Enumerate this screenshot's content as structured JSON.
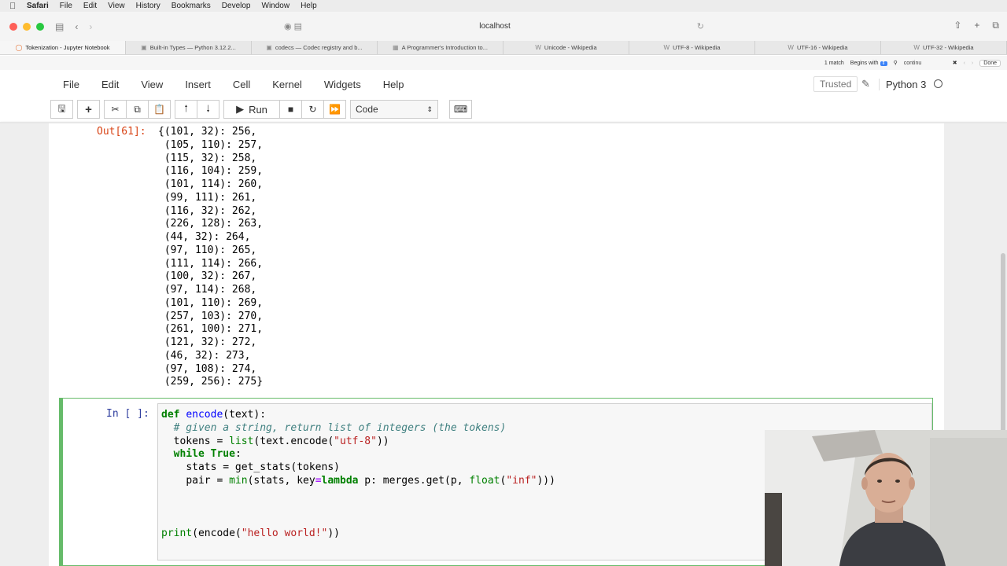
{
  "macos_menu": {
    "apple": "",
    "items": [
      "Safari",
      "File",
      "Edit",
      "View",
      "History",
      "Bookmarks",
      "Develop",
      "Window",
      "Help"
    ]
  },
  "browser": {
    "address": "localhost",
    "tabs": [
      {
        "label": "Tokenization - Jupyter Notebook",
        "active": true
      },
      {
        "label": "Built-in Types — Python 3.12.2...",
        "active": false
      },
      {
        "label": "codecs — Codec registry and b...",
        "active": false
      },
      {
        "label": "A Programmer's Introduction to...",
        "active": false
      },
      {
        "label": "Unicode - Wikipedia",
        "active": false
      },
      {
        "label": "UTF-8 - Wikipedia",
        "active": false
      },
      {
        "label": "UTF-16 - Wikipedia",
        "active": false
      },
      {
        "label": "UTF-32 - Wikipedia",
        "active": false
      }
    ],
    "find": {
      "match_count": "1 match",
      "mode": "Begins with",
      "query": "continu",
      "done": "Done"
    }
  },
  "jupyter": {
    "menu": [
      "File",
      "Edit",
      "View",
      "Insert",
      "Cell",
      "Kernel",
      "Widgets",
      "Help"
    ],
    "trusted": "Trusted",
    "kernel_name": "Python 3",
    "toolbar": {
      "run_label": "Run",
      "cell_type": "Code"
    }
  },
  "output_cell": {
    "prompt": "Out[61]:",
    "lines": [
      "{(101, 32): 256,",
      " (105, 110): 257,",
      " (115, 32): 258,",
      " (116, 104): 259,",
      " (101, 114): 260,",
      " (99, 111): 261,",
      " (116, 32): 262,",
      " (226, 128): 263,",
      " (44, 32): 264,",
      " (97, 110): 265,",
      " (111, 114): 266,",
      " (100, 32): 267,",
      " (97, 114): 268,",
      " (101, 110): 269,",
      " (257, 103): 270,",
      " (261, 100): 271,",
      " (121, 32): 272,",
      " (46, 32): 273,",
      " (97, 108): 274,",
      " (259, 256): 275}"
    ]
  },
  "input_cell": {
    "prompt": "In [ ]:",
    "code": {
      "l1_def": "def",
      "l1_name": "encode",
      "l1_rest": "(text):",
      "l2_comment": "# given a string, return list of integers (the tokens)",
      "l3_a": "tokens = ",
      "l3_list": "list",
      "l3_b": "(text.encode(",
      "l3_str": "\"utf-8\"",
      "l3_c": "))",
      "l4_while": "while",
      "l4_true": "True",
      "l4_colon": ":",
      "l5": "stats = get_stats(tokens)",
      "l6_a": "pair = ",
      "l6_min": "min",
      "l6_b": "(stats, key",
      "l6_eq": "=",
      "l6_lambda": "lambda",
      "l6_c": " p: merges.get(p, ",
      "l6_float": "float",
      "l6_d": "(",
      "l6_str": "\"inf\"",
      "l6_e": ")))",
      "l7_print": "print",
      "l7_a": "(encode(",
      "l7_str": "\"hello world!\"",
      "l7_b": "))"
    }
  }
}
